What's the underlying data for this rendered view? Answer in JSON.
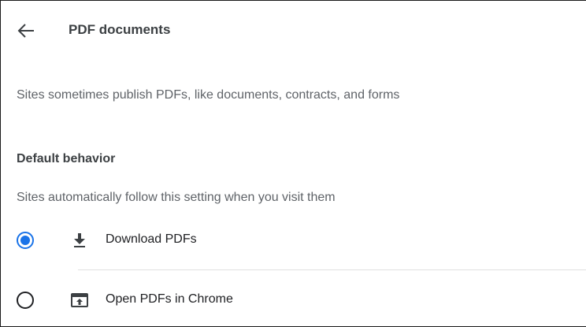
{
  "header": {
    "back_icon": "arrow-back-icon",
    "title": "PDF documents"
  },
  "description": "Sites sometimes publish PDFs, like documents, contracts, and forms",
  "default_behavior": {
    "heading": "Default behavior",
    "subtext": "Sites automatically follow this setting when you visit them",
    "options": [
      {
        "label": "Download PDFs",
        "icon": "download-icon",
        "selected": true
      },
      {
        "label": "Open PDFs in Chrome",
        "icon": "open-in-new-icon",
        "selected": false
      }
    ]
  },
  "colors": {
    "accent": "#1a73e8",
    "text_primary": "#202124",
    "text_secondary": "#5f6368"
  }
}
